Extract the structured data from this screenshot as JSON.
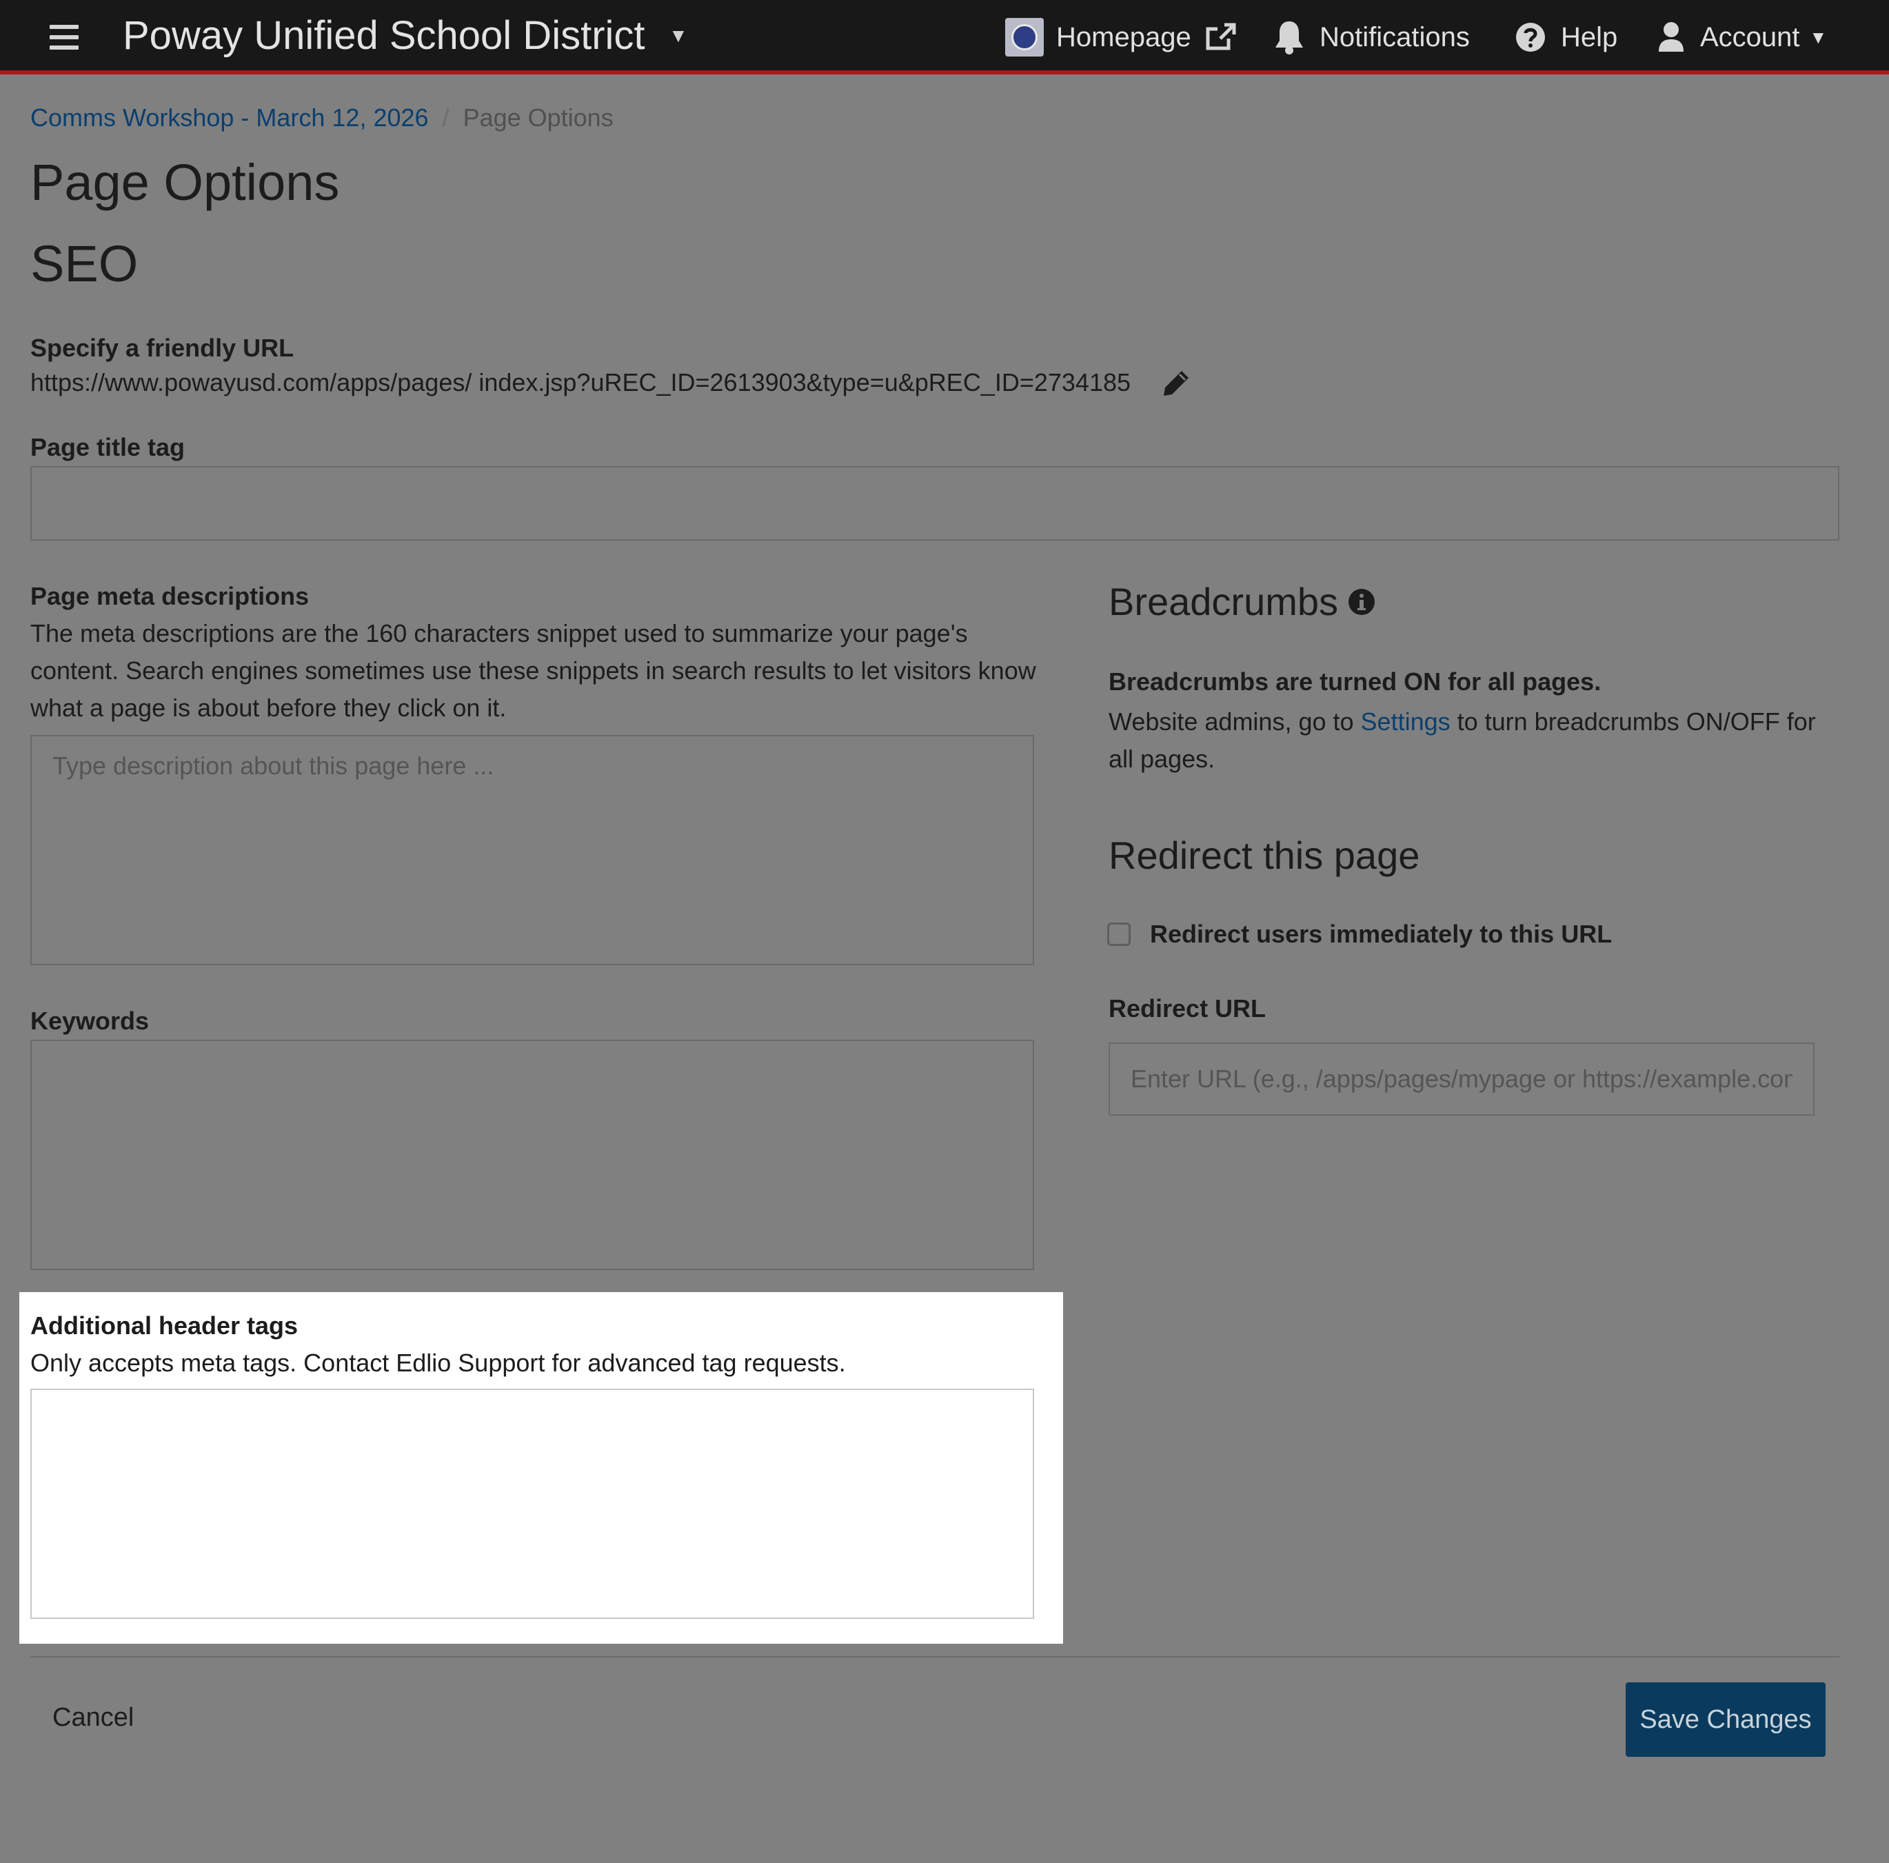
{
  "topbar": {
    "brand": "Poway Unified School District",
    "brand_caret": "▼",
    "homepage": "Homepage",
    "notifications": "Notifications",
    "help": "Help",
    "account": "Account",
    "account_caret": "▼"
  },
  "breadcrumb": {
    "parent": "Comms Workshop - March 12, 2026",
    "separator": "/",
    "current": "Page Options"
  },
  "page": {
    "title": "Page Options",
    "section_title": "SEO"
  },
  "seo": {
    "friendly_url_label": "Specify a friendly URL",
    "friendly_url_value": "https://www.powayusd.com/apps/pages/  index.jsp?uREC_ID=2613903&type=u&pREC_ID=2734185",
    "title_tag_label": "Page title tag",
    "title_tag_value": "",
    "meta_label": "Page meta descriptions",
    "meta_help": "The meta descriptions are the 160 characters snippet used to summarize your page's content. Search engines sometimes use these snippets in search results to let visitors know what a page is about before they click on it.",
    "meta_placeholder": "Type description about this page here ...",
    "keywords_label": "Keywords",
    "header_tags_label": "Additional header tags",
    "header_tags_help": "Only accepts meta tags. Contact Edlio Support for advanced tag requests."
  },
  "breadcrumbs_panel": {
    "title": "Breadcrumbs",
    "status": "Breadcrumbs are turned ON for all pages.",
    "help_before": "Website admins, go to ",
    "help_link": "Settings",
    "help_after": " to turn breadcrumbs ON/OFF for all pages."
  },
  "redirect": {
    "title": "Redirect this page",
    "checkbox_label": "Redirect users immediately to this URL",
    "checked": false,
    "url_label": "Redirect URL",
    "url_placeholder": "Enter URL (e.g., /apps/pages/mypage or https://example.com)"
  },
  "footer": {
    "cancel": "Cancel",
    "save": "Save Changes"
  },
  "colors": {
    "topbar": "#181818",
    "topbar_accent": "#b3151b",
    "overlay": "#808080",
    "link": "#0b3f6e",
    "primary_button": "#0a3b5e"
  },
  "icons": [
    "hamburger-icon",
    "school-seal-icon",
    "external-link-icon",
    "bell-icon",
    "question-circle-icon",
    "user-icon",
    "pencil-icon",
    "info-circle-icon"
  ]
}
